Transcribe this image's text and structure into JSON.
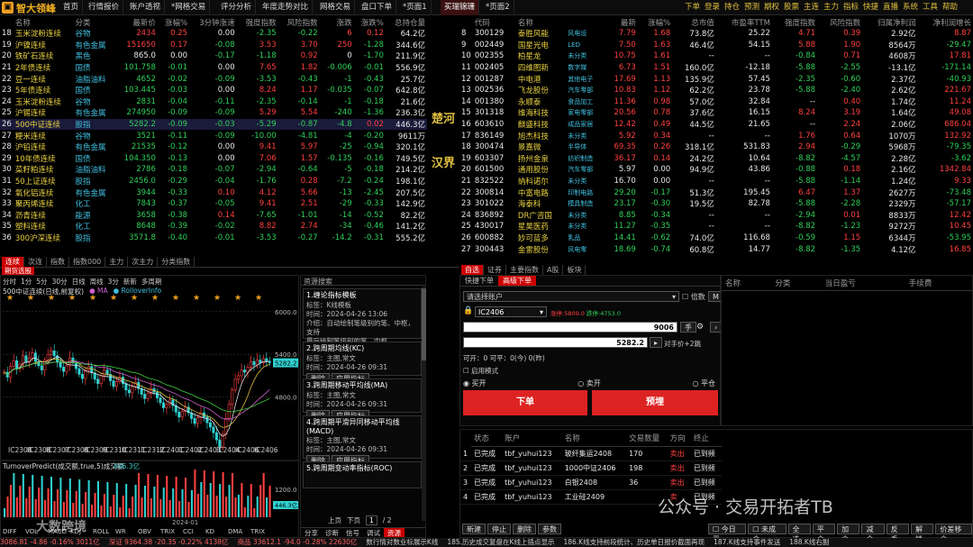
{
  "app": {
    "name": "智大领峰",
    "tabs": [
      "首页",
      "行情报价",
      "账户透视",
      "*网格交易",
      "评分分析",
      "年度走势对比",
      "网格交易",
      "盘口下单",
      "*页面1",
      "买瑞锦珊",
      "*页面2"
    ],
    "right_menu": [
      "下单",
      "登录",
      "持仓",
      "预测",
      "期权",
      "股票",
      "主连",
      "主力",
      "指标",
      "快捷",
      "直播",
      "系统",
      "工具",
      "帮助"
    ]
  },
  "futures": {
    "headers": [
      "名称",
      "分类",
      "最新价",
      "涨幅%",
      "3分钟涨速",
      "强度指数",
      "风险指数",
      "涨跌",
      "涨跌%",
      "总持仓量"
    ],
    "rows": [
      [
        "18",
        "玉米淀粉连续",
        "谷物",
        "2434",
        "0.25",
        "0.00",
        "-2.35",
        "-0.22",
        "6",
        "0.12",
        "64.2亿"
      ],
      [
        "19",
        "沪镍连续",
        "有色金属",
        "151650",
        "0.17",
        "-0.08",
        "3.53",
        "3.70",
        "250",
        "-1.28",
        "344.6亿"
      ],
      [
        "20",
        "铁矿石连续",
        "黑色",
        "865.0",
        "0.00",
        "-0.17",
        "-1.18",
        "0.92",
        "0",
        "-1.70",
        "211.9亿"
      ],
      [
        "21",
        "2年债连续",
        "国债",
        "101.758",
        "-0.01",
        "0.00",
        "7.65",
        "1.82",
        "-0.006",
        "-0.01",
        "556.9亿"
      ],
      [
        "22",
        "豆一连续",
        "油脂油料",
        "4652",
        "-0.02",
        "-0.09",
        "-3.53",
        "-0.43",
        "-1",
        "-0.43",
        "25.7亿"
      ],
      [
        "23",
        "5年债连续",
        "国债",
        "103.445",
        "-0.03",
        "0.00",
        "8.24",
        "1.17",
        "-0.035",
        "-0.07",
        "642.8亿"
      ],
      [
        "24",
        "玉米淀粉连续",
        "谷物",
        "2831",
        "-0.04",
        "-0.11",
        "-2.35",
        "-0.14",
        "-1",
        "-0.18",
        "21.6亿"
      ],
      [
        "25",
        "沪锡连续",
        "有色金属",
        "274950",
        "-0.09",
        "-0.09",
        "5.29",
        "5.54",
        "-240",
        "-1.36",
        "236.3亿"
      ],
      [
        "26",
        "500中证连续",
        "股指",
        "5282.2",
        "-0.09",
        "-0.03",
        "-5.29",
        "-0.87",
        "-4.8",
        "0.02",
        "446.3亿"
      ],
      [
        "27",
        "粳米连续",
        "谷物",
        "3521",
        "-0.11",
        "-0.09",
        "-10.00",
        "-4.81",
        "-4",
        "-0.20",
        "9611万"
      ],
      [
        "28",
        "沪铅连续",
        "有色金属",
        "21535",
        "-0.12",
        "0.00",
        "9.41",
        "5.97",
        "-25",
        "-0.94",
        "320.1亿"
      ],
      [
        "29",
        "10年债连续",
        "国债",
        "104.350",
        "-0.13",
        "0.00",
        "7.06",
        "1.57",
        "-0.135",
        "-0.16",
        "749.5亿"
      ],
      [
        "30",
        "菜籽粕连续",
        "油脂油料",
        "2786",
        "-0.18",
        "-0.07",
        "-2.94",
        "-0.64",
        "-5",
        "-0.18",
        "214.2亿"
      ],
      [
        "31",
        "50上证连续",
        "股指",
        "2456.0",
        "-0.29",
        "-0.04",
        "-1.76",
        "0.28",
        "-7.2",
        "-0.24",
        "198.1亿"
      ],
      [
        "32",
        "氧化铝连续",
        "有色金属",
        "3944",
        "-0.33",
        "0.10",
        "4.12",
        "5.66",
        "-13",
        "-2.45",
        "207.5亿"
      ],
      [
        "33",
        "聚丙烯连续",
        "化工",
        "7843",
        "-0.37",
        "-0.05",
        "9.41",
        "2.51",
        "-29",
        "-0.33",
        "142.9亿"
      ],
      [
        "34",
        "沥青连续",
        "能源",
        "3658",
        "-0.38",
        "0.14",
        "-7.65",
        "-1.01",
        "-14",
        "-0.52",
        "82.2亿"
      ],
      [
        "35",
        "塑料连续",
        "化工",
        "8648",
        "-0.39",
        "-0.02",
        "8.82",
        "2.74",
        "-34",
        "-0.46",
        "141.2亿"
      ],
      [
        "36",
        "300沪深连续",
        "股指",
        "3571.8",
        "-0.40",
        "-0.01",
        "-3.53",
        "-0.27",
        "-14.2",
        "-0.31",
        "555.2亿"
      ]
    ],
    "subtabs": [
      "连续",
      "次连",
      "指数",
      "指数000",
      "主力",
      "次主力",
      "分类指数"
    ]
  },
  "stocks": {
    "headers": [
      "代码",
      "名称",
      "最新",
      "涨幅%",
      "总市值",
      "市盈率TTM",
      "强度指数",
      "风险指数",
      "归属净利润",
      "净利润增长"
    ],
    "rows": [
      [
        "8",
        "300129",
        "泰胜风能",
        "风电设",
        "7.79",
        "1.68",
        "73.8亿",
        "25.22",
        "4.71",
        "0.39",
        "2.92亿",
        "8.87"
      ],
      [
        "9",
        "002449",
        "国星光电",
        "LED",
        "7.50",
        "1.63",
        "46.4亿",
        "54.15",
        "5.88",
        "1.90",
        "8564万",
        "-29.47"
      ],
      [
        "10",
        "002355",
        "柏星龙",
        "未分类",
        "10.75",
        "1.61",
        "--",
        "--",
        "-0.84",
        "0.71",
        "4608万",
        "17.81"
      ],
      [
        "11",
        "002405",
        "四维图新",
        "数字媒",
        "6.73",
        "1.51",
        "160.0亿",
        "-12.18",
        "-5.88",
        "-2.55",
        "-13.1亿",
        "-171.14"
      ],
      [
        "12",
        "001287",
        "中电港",
        "其他电子",
        "17.69",
        "1.13",
        "135.9亿",
        "57.45",
        "-2.35",
        "-0.60",
        "2.37亿",
        "-40.93"
      ],
      [
        "13",
        "002536",
        "飞龙股份",
        "汽车零部",
        "10.83",
        "1.12",
        "62.2亿",
        "23.78",
        "-5.88",
        "-2.40",
        "2.62亿",
        "221.67"
      ],
      [
        "14",
        "001380",
        "永顺泰",
        "食品加工",
        "11.36",
        "0.98",
        "57.0亿",
        "32.84",
        "--",
        "0.40",
        "1.74亿",
        "11.24"
      ],
      [
        "15",
        "301318",
        "维海科技",
        "家电零部",
        "20.56",
        "0.78",
        "37.6亿",
        "16.15",
        "8.24",
        "3.19",
        "1.64亿",
        "49.08"
      ],
      [
        "16",
        "603610",
        "麒盛科技",
        "成品家居",
        "12.42",
        "0.49",
        "44.5亿",
        "21.65",
        "--",
        "2.24",
        "2.06亿",
        "686.04"
      ],
      [
        "17",
        "836149",
        "旭杰科技",
        "未分类",
        "5.92",
        "0.34",
        "--",
        "--",
        "1.76",
        "0.64",
        "1070万",
        "132.92"
      ],
      [
        "18",
        "300474",
        "景嘉微",
        "半导体",
        "69.35",
        "0.26",
        "318.1亿",
        "531.83",
        "2.94",
        "-0.29",
        "5968万",
        "-79.35"
      ],
      [
        "19",
        "603307",
        "扬州金泉",
        "纺织制造",
        "36.17",
        "0.14",
        "24.2亿",
        "10.64",
        "-8.82",
        "-4.57",
        "2.28亿",
        "-3.62"
      ],
      [
        "20",
        "601500",
        "通用股份",
        "汽车零部",
        "5.97",
        "0.00",
        "94.9亿",
        "43.86",
        "-0.88",
        "0.18",
        "2.16亿",
        "1342.84"
      ],
      [
        "21",
        "832522",
        "纳科诺尔",
        "未分类",
        "16.70",
        "0.00",
        "--",
        "--",
        "-5.88",
        "-1.14",
        "1.24亿",
        "9.33"
      ],
      [
        "22",
        "300814",
        "中富电路",
        "印制电路",
        "29.20",
        "-0.17",
        "51.3亿",
        "195.45",
        "6.47",
        "1.37",
        "2627万",
        "-73.48"
      ],
      [
        "23",
        "301022",
        "海泰科",
        "模具制造",
        "23.17",
        "-0.30",
        "19.5亿",
        "82.78",
        "-5.88",
        "-2.28",
        "2329万",
        "-57.17"
      ],
      [
        "24",
        "836892",
        "DR广咨国",
        "未分类",
        "8.85",
        "-0.34",
        "--",
        "--",
        "-2.94",
        "0.01",
        "8833万",
        "12.42"
      ],
      [
        "25",
        "430017",
        "星昊医药",
        "未分类",
        "11.27",
        "-0.35",
        "--",
        "--",
        "-8.82",
        "-1.23",
        "9272万",
        "10.45"
      ],
      [
        "26",
        "600882",
        "妙可蓝多",
        "乳品",
        "14.41",
        "-0.62",
        "74.0亿",
        "116.68",
        "-0.59",
        "1.15",
        "6344万",
        "-53.95"
      ],
      [
        "27",
        "300443",
        "金雷股份",
        "风电零",
        "18.69",
        "-0.74",
        "60.8亿",
        "14.77",
        "-8.82",
        "-1.35",
        "4.12亿",
        "16.85"
      ]
    ],
    "subtabs": [
      "自选",
      "证券",
      "主要指数",
      "A股",
      "板块"
    ]
  },
  "river": {
    "top": "楚河",
    "bottom": "汉界"
  },
  "chart": {
    "toolbar": [
      "分时",
      "1分",
      "5分",
      "30分",
      "日线",
      "周线",
      "3分",
      "新新",
      "多周期"
    ],
    "title": "500中证连续(日线,前复权)",
    "legend": [
      "MA",
      "RolloverInfo"
    ],
    "price_labels": [
      "6000.0",
      "5400.0",
      "4800.0"
    ],
    "current_price": "5282.2",
    "x_labels": [
      "IC2308",
      "IC2308",
      "IC2307",
      "IC2308",
      "IC2309",
      "IC2310",
      "IC2311",
      "IC2312",
      "IC2401",
      "IC2402",
      "IC2403",
      "IC2404",
      "IC2406",
      "IC2406"
    ],
    "indicator_title": "TurnoverPredict(成交额,true,5)成交额",
    "indicator_value": "446.3亿",
    "ind_labels": [
      "1200.0",
      "600.0"
    ],
    "bottom_tabs": [
      "DIFF",
      "VOL",
      "MACD",
      "KDJ",
      "ROLL",
      "WR",
      "OBV",
      "TRIX",
      "CCI",
      "KD",
      "DMA",
      "TRIX"
    ],
    "year_label": "2024-01",
    "close_series": [
      5150,
      5080,
      5230,
      5310,
      5200,
      5260,
      5380,
      5290,
      5350,
      5420,
      5300,
      5240,
      5180,
      5320,
      5400,
      5450,
      5380,
      5300,
      5220,
      5160,
      5240,
      5350,
      5280,
      5200,
      5120,
      5060,
      5180,
      5230,
      5140,
      5050,
      4990,
      5100,
      5180,
      5120,
      5030,
      4950,
      5020,
      5080,
      4990,
      4900,
      4860,
      4950,
      5010,
      4920,
      4840,
      4780,
      4850,
      4920,
      4870,
      4790,
      4720,
      4650,
      4700,
      4760,
      4680,
      4590,
      4520,
      4600,
      4660,
      4580,
      4500,
      4430,
      4510,
      4580,
      4520,
      4440,
      4380,
      4300,
      4200,
      4100,
      4280,
      4500,
      4700,
      4900,
      5050,
      5100,
      5180,
      5150,
      5220,
      5300,
      5250,
      5320,
      5280,
      5340,
      5300,
      5282
    ]
  },
  "indicators": {
    "header": "资源搜索",
    "items": [
      {
        "title": "1.缠论指标模板",
        "lines": [
          "标签：K线模板",
          "时间：2024-04-26 13:06",
          "介绍：自动绘制笔级别的笔、中枢，支持",
          "最后绘制笔级别的笔、中枢"
        ],
        "buttons": [
          "删除",
          "应用模板",
          "存为模板"
        ]
      },
      {
        "title": "2.跨周期均线(KC)",
        "lines": [
          "标签：主图,常文",
          "时间：2024-04-26 09:31"
        ],
        "buttons": [
          "删除",
          "应用指标"
        ]
      },
      {
        "title": "3.跨周期移动平均线(MA)",
        "lines": [
          "标签：主图,常文",
          "时间：2024-04-26 09:31"
        ],
        "buttons": [
          "删除",
          "应用指标"
        ]
      },
      {
        "title": "4.跨周期平滑异同移动平均线(MACD)",
        "lines": [
          "标签：主图,常文",
          "时间：2024-04-26 09:31"
        ],
        "buttons": [
          "删除",
          "应用指标"
        ]
      },
      {
        "title": "5.跨周期变动率指标(ROC)",
        "lines": [],
        "buttons": []
      }
    ],
    "pager": {
      "prev": "上页",
      "next": "下页",
      "page": "1",
      "total": "/ 2"
    },
    "bottom_tabs": [
      "分享",
      "诊断",
      "信号",
      "调试",
      "资源"
    ]
  },
  "order": {
    "tabs": [
      "快捷下单",
      "高级下单"
    ],
    "account_placeholder": "请选择账户",
    "multiplier_label": "倍数",
    "mult_btn": "M",
    "contract": "IC2406",
    "limit_up": "涨停:5809.0",
    "limit_down": "跌停:4753.0",
    "qty_label": "数量",
    "qty": "9006",
    "hand": "手",
    "price": "5282.2",
    "price_mode": "对手价+2跳",
    "available": "可开：0  可平：0(今) 0(昨)",
    "enable_mode": "启用模式",
    "dirs": [
      "买开",
      "卖开",
      "平仓"
    ],
    "buy_btn": "下单",
    "pre_btn": "预埋"
  },
  "positions": {
    "headers": [
      "名称",
      "分类",
      "当日盈亏",
      "手续费"
    ]
  },
  "orders": {
    "headers": [
      "状态",
      "账户",
      "名称",
      "交易数量",
      "方向",
      "终止"
    ],
    "rows": [
      [
        "1",
        "已完成",
        "tbf_yuhui123",
        "玻纤集运2408",
        "170",
        "卖出",
        "已到频"
      ],
      [
        "2",
        "已完成",
        "tbf_yuhui123",
        "1000中证2406",
        "198",
        "卖出",
        "已到频"
      ],
      [
        "3",
        "已完成",
        "tbf_yuhui123",
        "白银2408",
        "36",
        "卖出",
        "已到频"
      ],
      [
        "4",
        "已完成",
        "tbf_yuhui123",
        "工业硅2409",
        "",
        "卖",
        "已到频"
      ]
    ],
    "bottom_buttons": [
      "新建",
      "停止",
      "删除",
      "参数"
    ],
    "right_controls": [
      "今日平",
      "未成合",
      "全选",
      "平仓",
      "加仓",
      "减仓",
      "反手",
      "解锁",
      "价差移仓"
    ]
  },
  "status": {
    "items": [
      "3086.81 -4.86 -0.16% 3011亿",
      "深证 9364.38 -20.35 -0.22% 4138亿",
      "商品 33612.1 -94.0 -0.28% 22630亿",
      "数行情对数业标展示K线",
      "185.历史成交复盘在K线上插点显示",
      "186.K线支持前段统计、历史单日报价截面再现",
      "187.K线支持事件发送",
      "188.K线右副"
    ]
  },
  "watermark": {
    "left": "大数跨境",
    "right": "公众号 · 交易开拓者TB"
  },
  "colors": {
    "up": "#ff4040",
    "down": "#2fd05a",
    "accent": "#c00000"
  }
}
